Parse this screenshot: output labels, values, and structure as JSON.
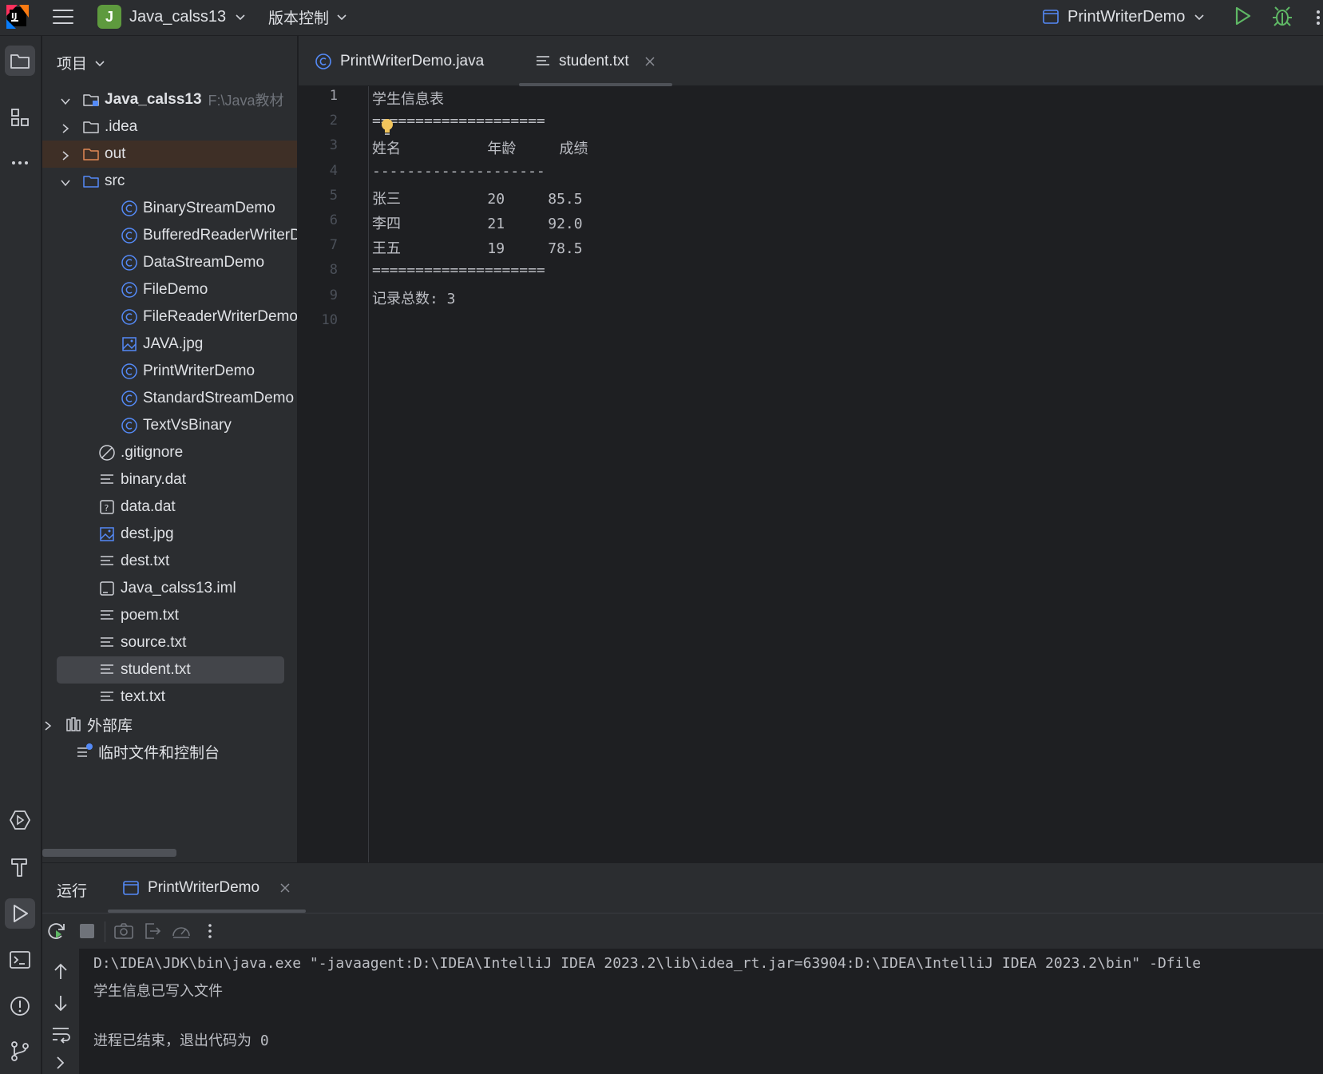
{
  "titlebar": {
    "project_initial": "J",
    "project_name": "Java_calss13",
    "vcs_label": "版本控制",
    "run_config": "PrintWriterDemo"
  },
  "project_panel": {
    "title": "项目",
    "root": {
      "label": "Java_calss13",
      "path": "F:\\Java教材"
    },
    "items": [
      {
        "label": ".idea",
        "icon": "folder-icon"
      },
      {
        "label": "out",
        "icon": "folder-icon"
      },
      {
        "label": "src",
        "icon": "folder-icon"
      },
      {
        "label": "BinaryStreamDemo",
        "icon": "class-icon"
      },
      {
        "label": "BufferedReaderWriterDemo",
        "icon": "class-icon"
      },
      {
        "label": "DataStreamDemo",
        "icon": "class-icon"
      },
      {
        "label": "FileDemo",
        "icon": "class-icon"
      },
      {
        "label": "FileReaderWriterDemo",
        "icon": "class-icon"
      },
      {
        "label": "JAVA.jpg",
        "icon": "image-icon"
      },
      {
        "label": "PrintWriterDemo",
        "icon": "class-icon"
      },
      {
        "label": "StandardStreamDemo",
        "icon": "class-icon"
      },
      {
        "label": "TextVsBinary",
        "icon": "class-icon"
      },
      {
        "label": ".gitignore",
        "icon": "ignore-file-icon"
      },
      {
        "label": "binary.dat",
        "icon": "text-file-icon"
      },
      {
        "label": "data.dat",
        "icon": "unknown-file-icon"
      },
      {
        "label": "dest.jpg",
        "icon": "image-icon"
      },
      {
        "label": "dest.txt",
        "icon": "text-file-icon"
      },
      {
        "label": "Java_calss13.iml",
        "icon": "module-file-icon"
      },
      {
        "label": "poem.txt",
        "icon": "text-file-icon"
      },
      {
        "label": "source.txt",
        "icon": "text-file-icon"
      },
      {
        "label": "student.txt",
        "icon": "text-file-icon"
      },
      {
        "label": "text.txt",
        "icon": "text-file-icon"
      },
      {
        "label": "外部库",
        "icon": "library-icon"
      },
      {
        "label": "临时文件和控制台",
        "icon": "scratch-icon"
      }
    ]
  },
  "editor_tabs": [
    {
      "label": "PrintWriterDemo.java",
      "icon": "class-icon"
    },
    {
      "label": "student.txt",
      "icon": "text-file-icon"
    }
  ],
  "editor": {
    "lines": [
      "学生信息表",
      "====================",
      "姓名          年龄     成绩",
      "--------------------",
      "张三          20     85.5",
      "李四          21     92.0",
      "王五          19     78.5",
      "====================",
      "记录总数: 3",
      ""
    ]
  },
  "run_panel": {
    "title": "运行",
    "tab_label": "PrintWriterDemo",
    "console": [
      "D:\\IDEA\\JDK\\bin\\java.exe \"-javaagent:D:\\IDEA\\IntelliJ IDEA 2023.2\\lib\\idea_rt.jar=63904:D:\\IDEA\\IntelliJ IDEA 2023.2\\bin\" -Dfile",
      "学生信息已写入文件",
      "",
      "进程已结束，退出代码为 0"
    ]
  },
  "colors": {
    "accent_blue": "#548af7",
    "run_green": "#5fb865",
    "bulb_yellow": "#f2c55c"
  }
}
